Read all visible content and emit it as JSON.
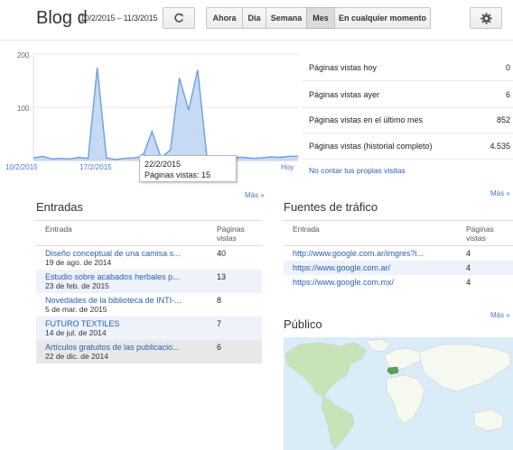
{
  "header": {
    "title": "Blog d",
    "date_range": "10/2/2015 – 11/3/2015",
    "refresh_icon": "refresh-icon",
    "ranges": [
      "Ahora",
      "Día",
      "Semana",
      "Mes",
      "En cualquier momento"
    ],
    "selected_range": "Mes",
    "settings_icon": "gear-icon"
  },
  "chart_data": {
    "type": "area",
    "title": "",
    "xlabel": "",
    "ylabel": "",
    "ylim": [
      0,
      200
    ],
    "y_ticks": [
      "200",
      "100"
    ],
    "x_tick_labels": [
      "10/2/2015",
      "17/2/2015",
      "Hoy"
    ],
    "x_tick_dates": [
      "10/2/2015",
      "17/2/2015",
      "11/3/2015"
    ],
    "x": [
      "10/2/2015",
      "11/2/2015",
      "12/2/2015",
      "13/2/2015",
      "14/2/2015",
      "15/2/2015",
      "16/2/2015",
      "17/2/2015",
      "18/2/2015",
      "19/2/2015",
      "20/2/2015",
      "21/2/2015",
      "22/2/2015",
      "23/2/2015",
      "24/2/2015",
      "25/2/2015",
      "26/2/2015",
      "27/2/2015",
      "28/2/2015",
      "1/3/2015",
      "2/3/2015",
      "3/3/2015",
      "4/3/2015",
      "5/3/2015",
      "6/3/2015",
      "7/3/2015",
      "8/3/2015",
      "9/3/2015",
      "10/3/2015",
      "11/3/2015"
    ],
    "values": [
      5,
      8,
      3,
      4,
      3,
      6,
      4,
      175,
      5,
      2,
      4,
      5,
      8,
      55,
      5,
      20,
      155,
      95,
      170,
      8,
      7,
      5,
      6,
      6,
      4,
      5,
      7,
      6,
      8,
      8
    ],
    "grid": true,
    "tooltip": {
      "date": "22/2/2015",
      "text": "Páginas vistas: 15"
    }
  },
  "stats": {
    "rows": [
      {
        "label": "Páginas vistas hoy",
        "value": "0"
      },
      {
        "label": "Páginas vistas ayer",
        "value": "6"
      },
      {
        "label": "Páginas vistas en el último mes",
        "value": "852"
      },
      {
        "label": "Páginas vistas (historial completo)",
        "value": "4.535"
      }
    ],
    "exclude_link": "No contar tus propias visitas"
  },
  "entradas": {
    "title": "Entradas",
    "more": "Más »",
    "col_entry": "Entrada",
    "col_views_1": "Páginas",
    "col_views_2": "vistas",
    "rows": [
      {
        "title": "Diseño conceptual de una camisa s...",
        "date": "19 de ago. de 2014",
        "views": "40"
      },
      {
        "title": "Estudio sobre acabados herbales p...",
        "date": "23 de feb. de 2015",
        "views": "13"
      },
      {
        "title": "Novedades de la biblioteca de INTI-...",
        "date": "5 de mar. de 2015",
        "views": "8"
      },
      {
        "title": "FUTURO TEXTILES",
        "date": "14 de jul. de 2014",
        "views": "7"
      },
      {
        "title": "Artículos gratuitos de las publicacio...",
        "date": "22 de dic. de 2014",
        "views": "6"
      }
    ]
  },
  "fuentes": {
    "title": "Fuentes de tráfico",
    "more": "Más »",
    "col_entry": "Entrada",
    "col_views_1": "Páginas",
    "col_views_2": "vistas",
    "rows": [
      {
        "url": "http://www.google.com.ar/imgres?i...",
        "views": "4"
      },
      {
        "url": "https://www.google.com.ar/",
        "views": "4"
      },
      {
        "url": "https://www.google.com.mx/",
        "views": "4"
      }
    ]
  },
  "publico": {
    "title": "Público",
    "more": "Más »"
  },
  "colors": {
    "area_fill": "#bcd4f3",
    "area_line": "#6e9fdc",
    "map_ocean": "#d9ecf8",
    "map_land": "#f6f9f0",
    "map_highlight": "#5aa35a",
    "map_light": "#c9e3b8"
  }
}
